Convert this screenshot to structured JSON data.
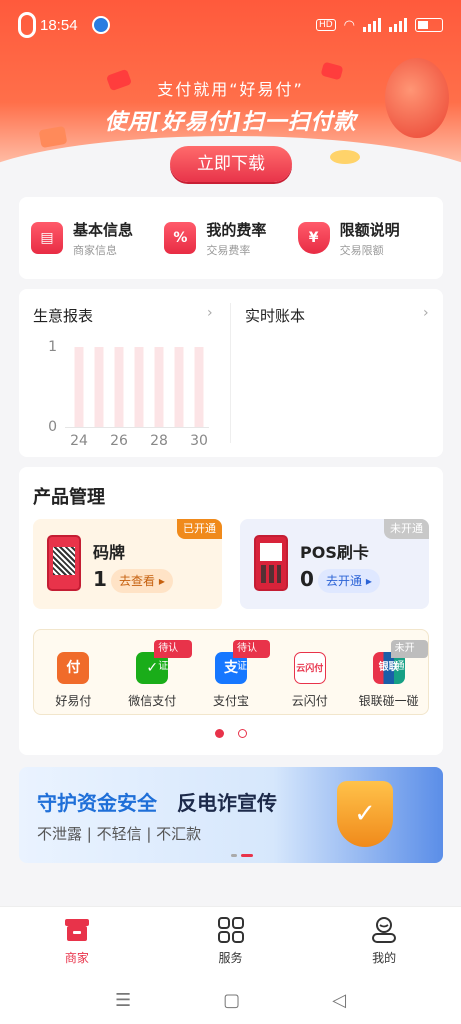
{
  "status_bar": {
    "indicator": "0",
    "time": "18:54",
    "network": "HD",
    "battery": "34"
  },
  "banner": {
    "line1": "支付就用“好易付”",
    "line2": "使用[好易付]扫一扫付款",
    "button_label": "立即下载"
  },
  "quick_links": [
    {
      "title": "基本信息",
      "subtitle": "商家信息",
      "icon": "merchant-info-icon"
    },
    {
      "title": "我的费率",
      "subtitle": "交易费率",
      "icon": "rate-icon",
      "glyph": "%"
    },
    {
      "title": "限额说明",
      "subtitle": "交易限额",
      "icon": "limit-shield-icon",
      "glyph": "¥"
    }
  ],
  "report": {
    "title": "生意报表",
    "ledger_title": "实时账本",
    "chevron": "›"
  },
  "chart_data": {
    "type": "bar",
    "categories": [
      "24",
      "25",
      "26",
      "27",
      "28",
      "29",
      "30"
    ],
    "x_tick_labels": [
      "24",
      "26",
      "28",
      "30"
    ],
    "values": [
      1,
      1,
      1,
      1,
      1,
      1,
      1
    ],
    "ylim": [
      0,
      1
    ],
    "y_ticks": [
      "0",
      "1"
    ],
    "bar_color": "#fce4e6",
    "grid": false
  },
  "products": {
    "title": "产品管理",
    "items": [
      {
        "name": "码牌",
        "count": "1",
        "action": "去查看",
        "status": "已开通"
      },
      {
        "name": "POS刷卡",
        "count": "0",
        "action": "去开通",
        "status": "未开通"
      }
    ]
  },
  "payments": [
    {
      "label": "好易付",
      "icon": "haoyifu-icon",
      "glyph": "付",
      "color": "#f06b2a",
      "tag": ""
    },
    {
      "label": "微信支付",
      "icon": "wechat-pay-icon",
      "glyph": "✓",
      "color": "#1aad19",
      "tag": "待认证"
    },
    {
      "label": "支付宝",
      "icon": "alipay-icon",
      "glyph": "支",
      "color": "#1677ff",
      "tag": "待认证"
    },
    {
      "label": "云闪付",
      "icon": "unionpay-quickpass-icon",
      "glyph": "云闪付",
      "color": "#e8334a",
      "tag": ""
    },
    {
      "label": "银联碰一碰",
      "icon": "unionpay-tap-icon",
      "glyph": "银联",
      "color": "#1a5fa8",
      "tag": "未开通"
    }
  ],
  "promo": {
    "title_blue": "守护资金安全",
    "title_dark": "反电诈宣传",
    "subtitle": "不泄露 | 不轻信 | 不汇款"
  },
  "nav": [
    {
      "label": "商家",
      "icon": "store-icon",
      "active": true
    },
    {
      "label": "服务",
      "icon": "grid-icon",
      "active": false
    },
    {
      "label": "我的",
      "icon": "profile-icon",
      "active": false
    }
  ],
  "system_nav": {
    "menu": "☰",
    "home": "▢",
    "back": "◁"
  },
  "colors": {
    "brand_red": "#e8334a",
    "banner_orange": "#ff5a3c",
    "accent_orange": "#f08a1b",
    "link_blue": "#2b63d6"
  }
}
